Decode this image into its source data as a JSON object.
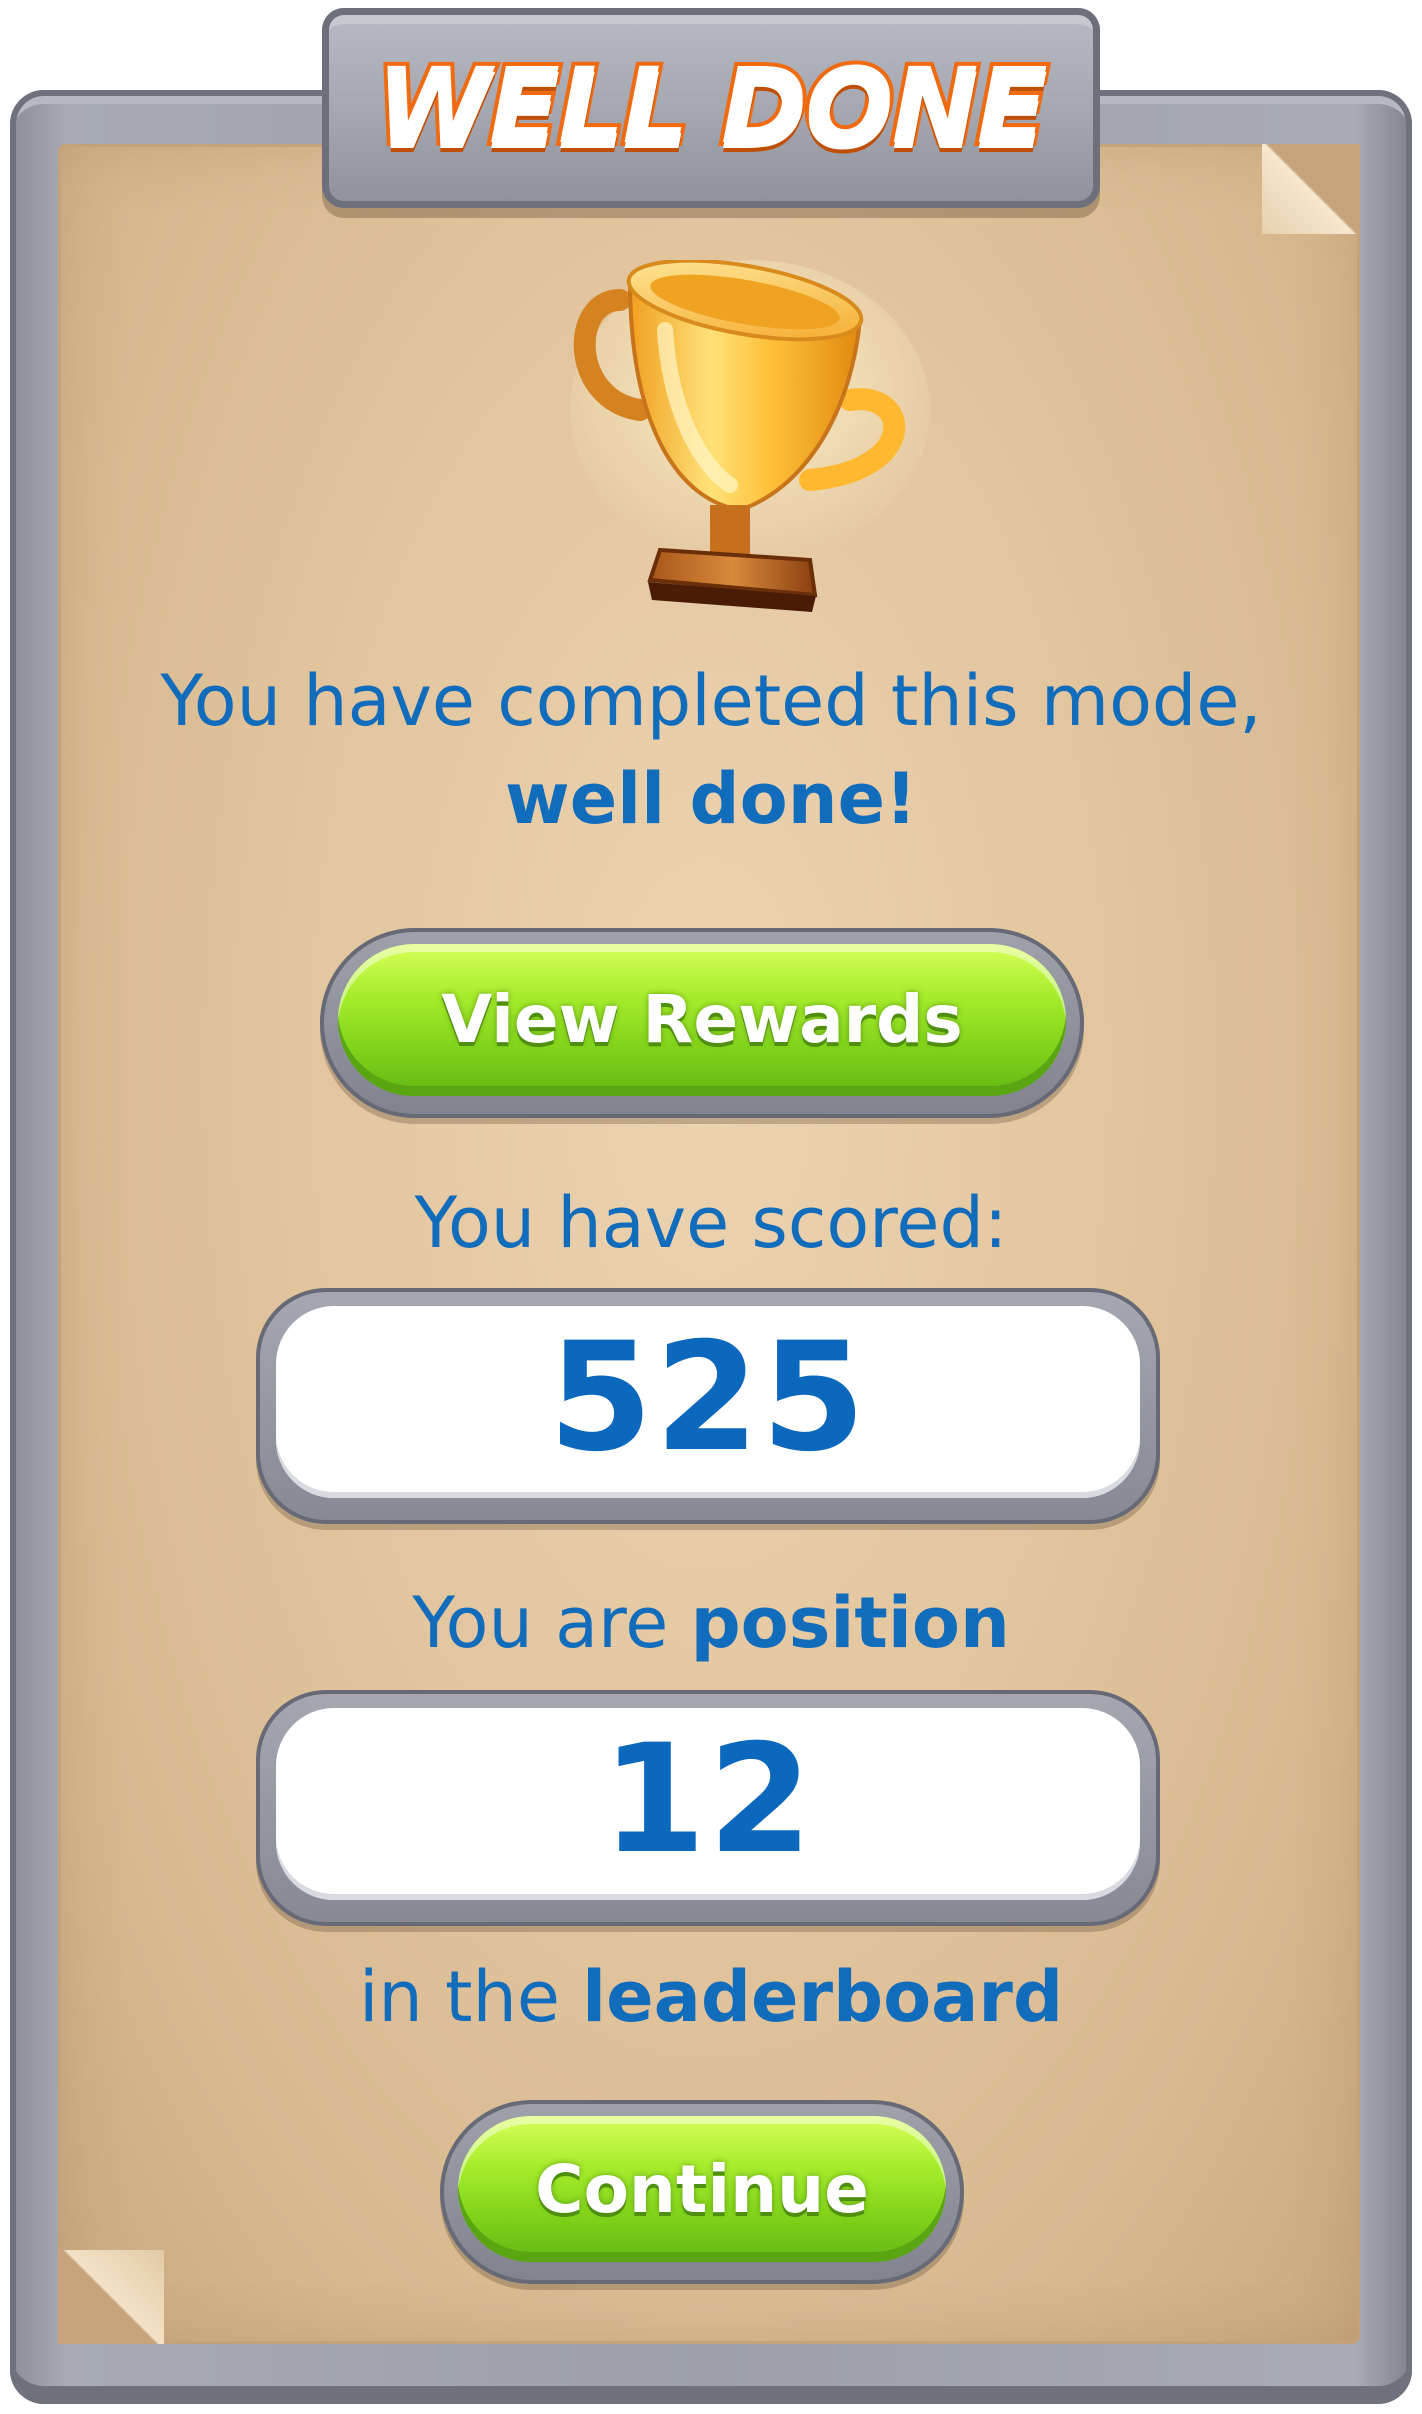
{
  "header": {
    "title": "WELL DONE"
  },
  "completion": {
    "text_prefix": "You have completed this mode,",
    "text_bold": "well done!"
  },
  "buttons": {
    "view_rewards": "View Rewards",
    "continue": "Continue"
  },
  "score": {
    "label": "You have scored:",
    "value": "525"
  },
  "position": {
    "label_prefix": "You are",
    "label_bold": "position",
    "value": "12",
    "suffix_prefix": "in the",
    "suffix_bold": "leaderboard"
  },
  "colors": {
    "text_blue": "#126cbc",
    "title_orange": "#f06a10",
    "button_green": "#8fdc22",
    "stone_gray": "#9c9fa8",
    "paper": "#e2c59e"
  },
  "icons": {
    "trophy": "trophy-icon"
  }
}
